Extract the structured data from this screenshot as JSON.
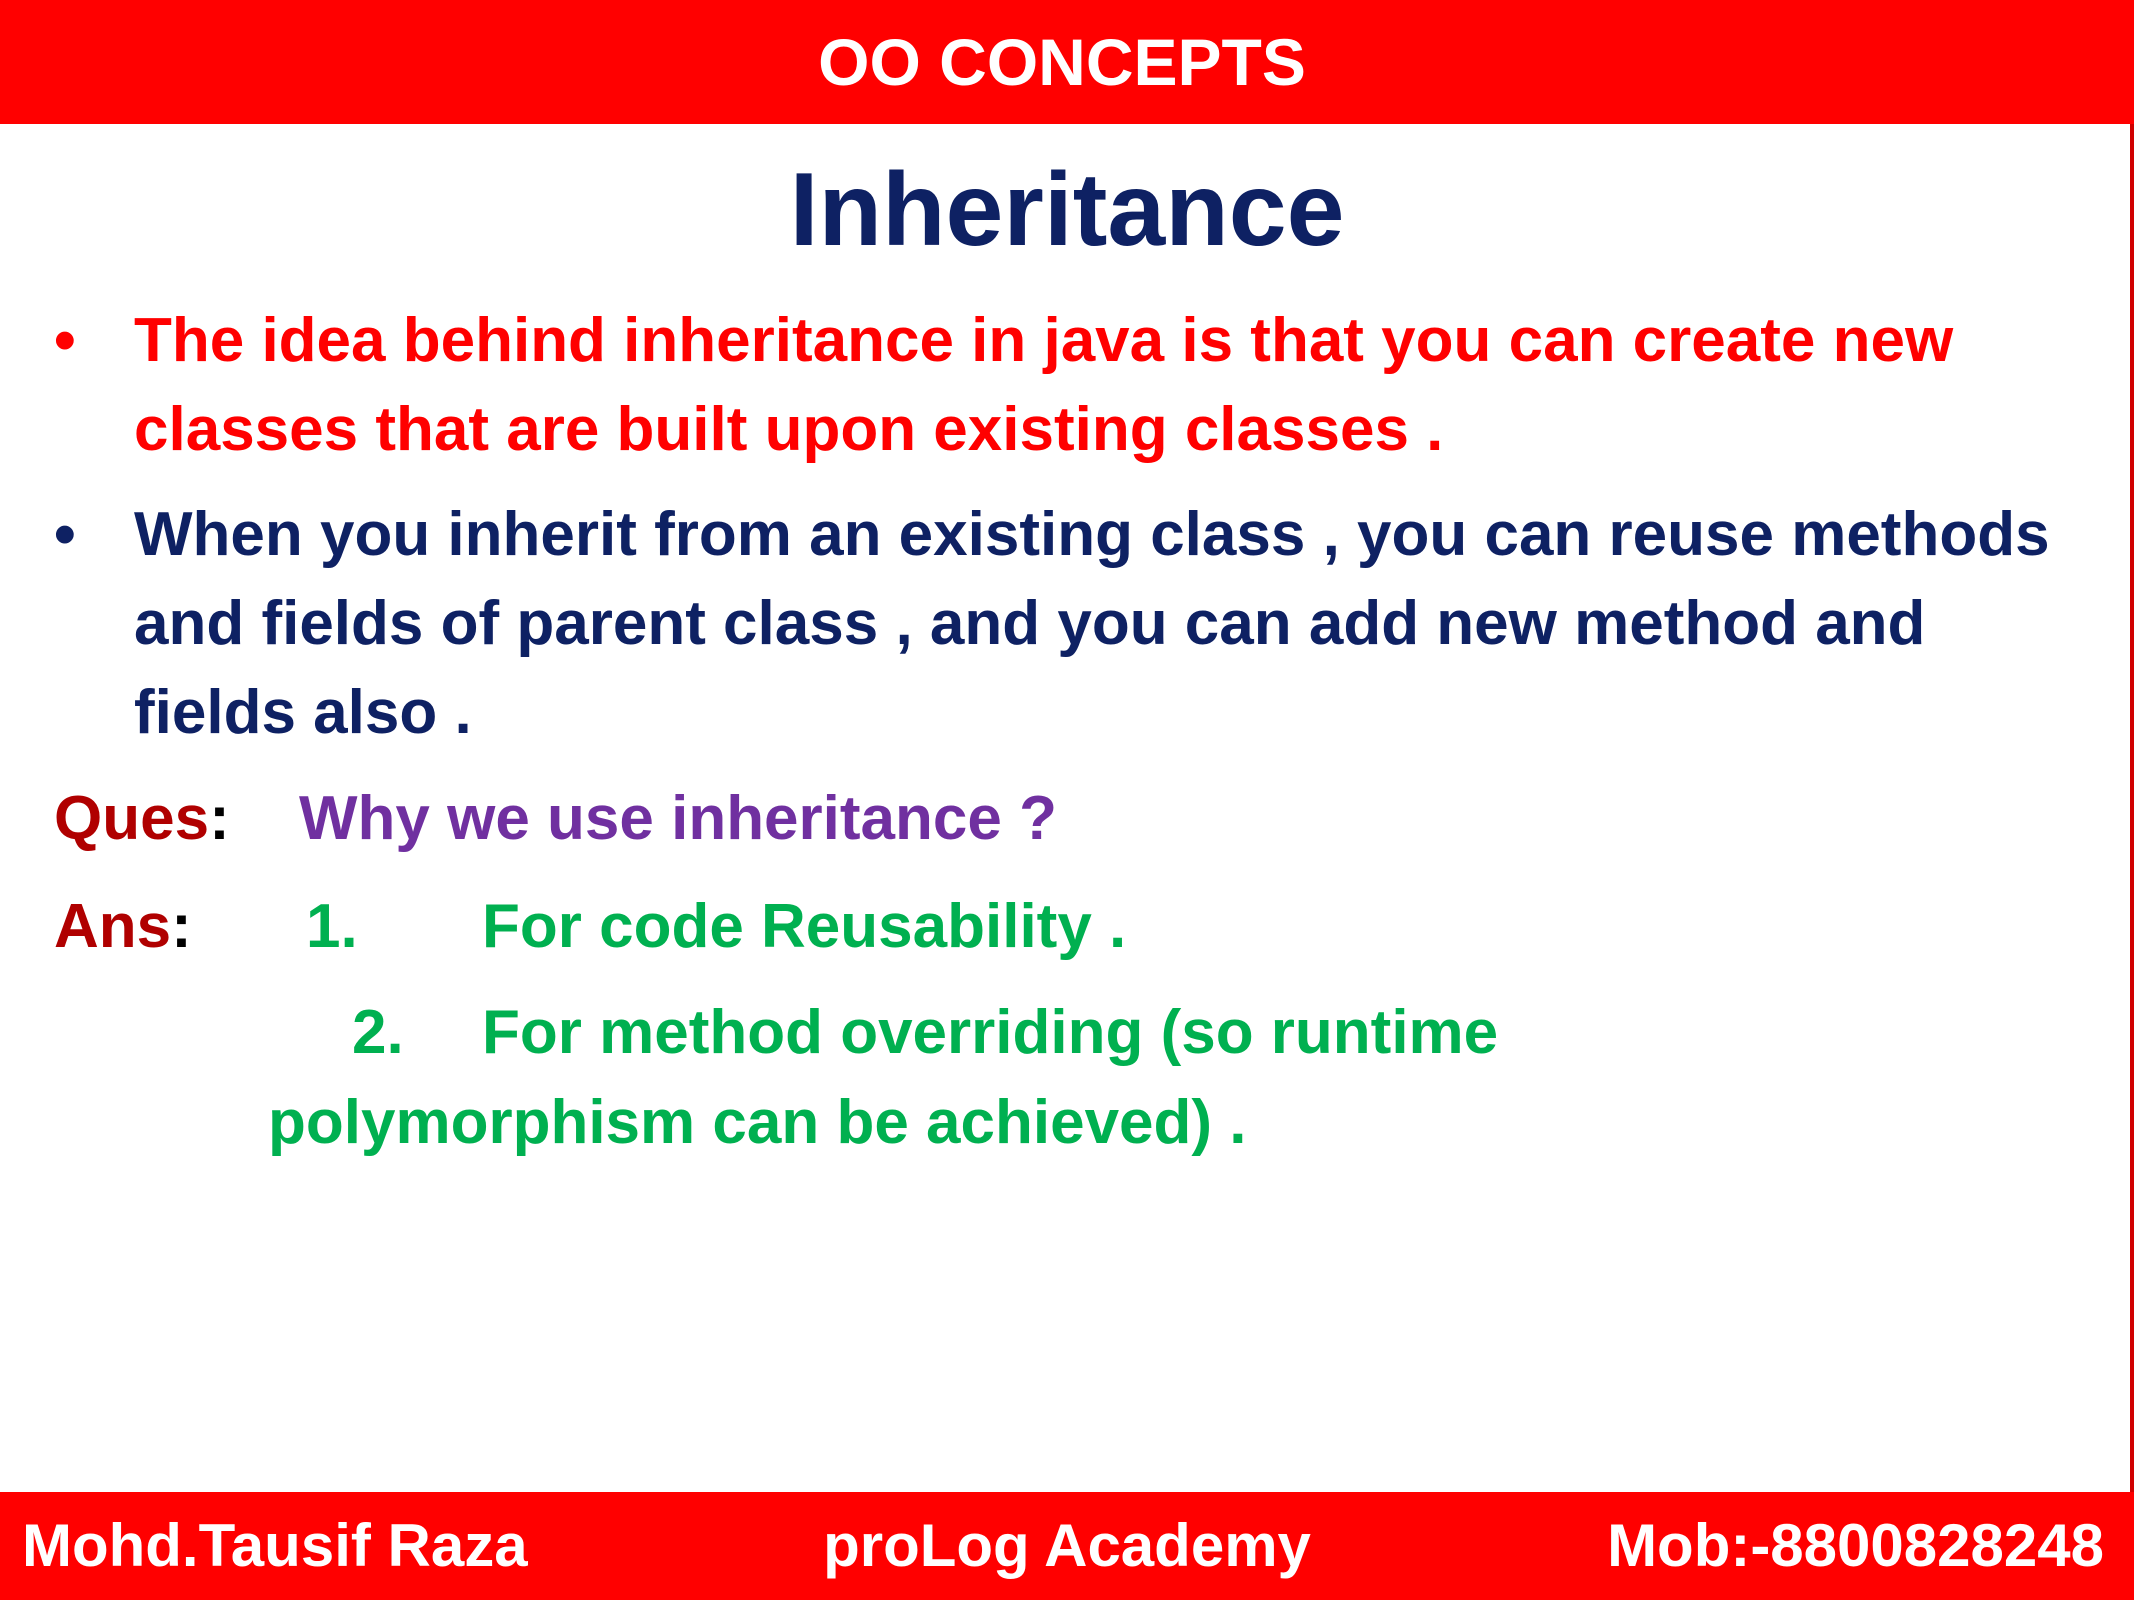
{
  "header": {
    "title": "OO CONCEPTS"
  },
  "slide": {
    "title": "Inheritance"
  },
  "bullets": [
    {
      "marker": "•",
      "text": "The idea behind inheritance in java is that you can create new classes that are built upon existing classes .",
      "color": "#ff0000"
    },
    {
      "marker": "•",
      "text": "When you inherit from an existing class , you can reuse methods and fields of parent class , and you can add new method and fields also .",
      "color": "#0e2163"
    }
  ],
  "question": {
    "label": "Ques",
    "colon": ":",
    "text": "Why we use inheritance ?"
  },
  "answer": {
    "label": "Ans",
    "colon": ":",
    "items": [
      {
        "number": "1.",
        "text": "For code Reusability ."
      },
      {
        "number": "2.",
        "text_line1": "For method overriding (so runtime",
        "text_line2": "polymorphism can be achieved) ."
      }
    ]
  },
  "footer": {
    "left": "Mohd.Tausif Raza",
    "center": "proLog Academy",
    "right": "Mob:-8800828248"
  },
  "colors": {
    "banner": "#ff0000",
    "title": "#0e2163",
    "question": "#7030a0",
    "answer": "#00b050",
    "label": "#b00000"
  }
}
